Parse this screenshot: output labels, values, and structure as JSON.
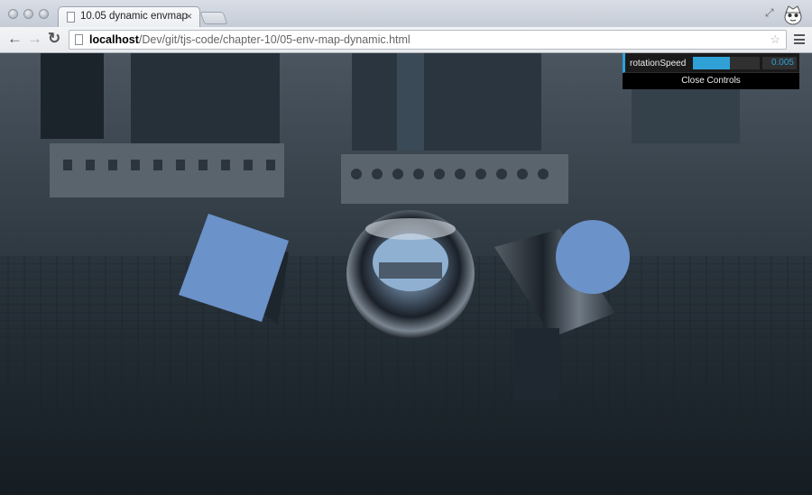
{
  "window": {
    "tab_title": "10.05 dynamic envmap",
    "tab_close": "×"
  },
  "toolbar": {
    "back_glyph": "←",
    "forward_glyph": "→",
    "reload_glyph": "↻",
    "url_host": "localhost",
    "url_path": "/Dev/git/tjs-code/chapter-10/05-env-map-dynamic.html",
    "star_glyph": "☆"
  },
  "icons": {
    "back": "back-arrow-icon",
    "forward": "forward-arrow-icon",
    "reload": "reload-icon",
    "bookmark": "star-icon",
    "menu": "hamburger-menu-icon",
    "page": "document-icon",
    "profile": "incognito-profile-icon",
    "fullscreen": "expand-icon"
  },
  "controls": {
    "rotation_speed_label": "rotationSpeed",
    "rotation_speed_value": "0.005",
    "rotation_speed_fraction": 0.55,
    "close_label": "Close Controls"
  },
  "colors": {
    "gui_accent": "#2fa1d6",
    "shape_face": "#6b92c9",
    "scene_background": "#1a2530"
  }
}
